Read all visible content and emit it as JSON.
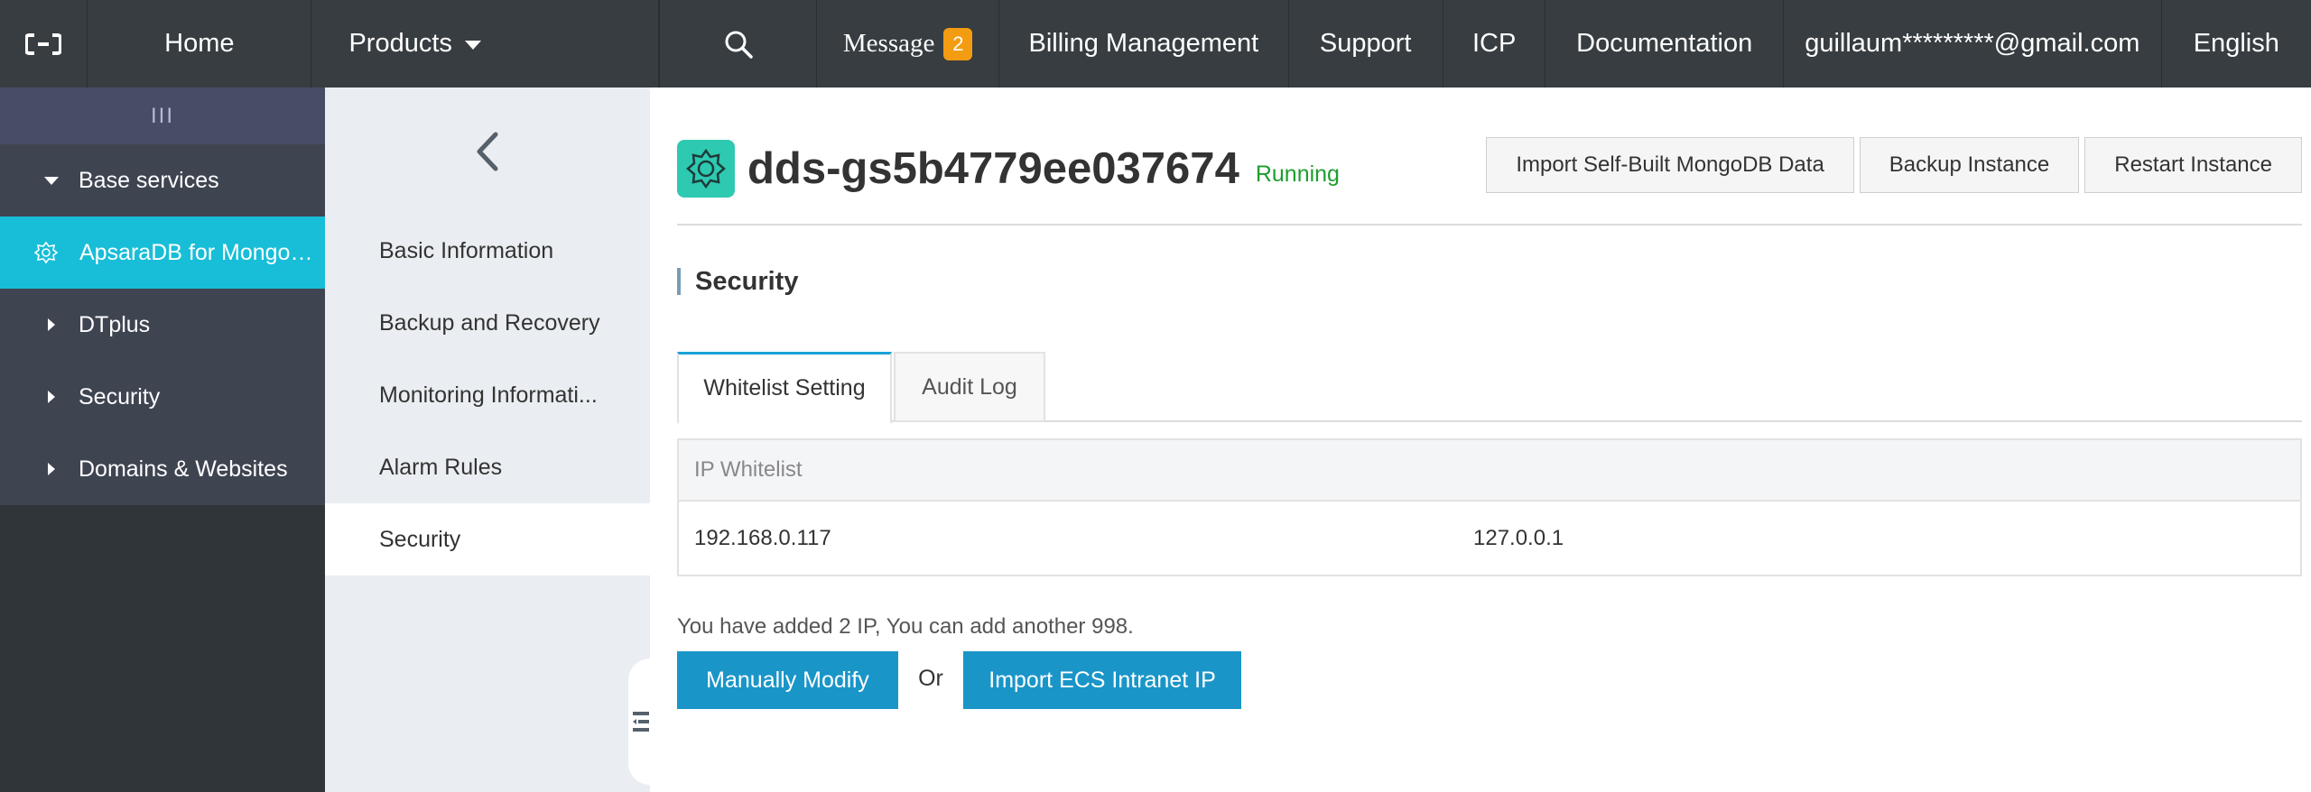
{
  "topbar": {
    "logo_icon": "aliyun-logo-icon",
    "home": "Home",
    "products": "Products",
    "message": "Message",
    "message_count": "2",
    "billing": "Billing Management",
    "support": "Support",
    "icp": "ICP",
    "documentation": "Documentation",
    "account": "guillaum*********@gmail.com",
    "language": "English"
  },
  "sidebar": {
    "collapse_glyph": "III",
    "items": [
      {
        "label": "Base services",
        "state": "expanded"
      },
      {
        "label": "ApsaraDB for MongoDB",
        "state": "active"
      },
      {
        "label": "DTplus",
        "state": "collapsed"
      },
      {
        "label": "Security",
        "state": "collapsed"
      },
      {
        "label": "Domains & Websites",
        "state": "collapsed"
      }
    ]
  },
  "subnav": {
    "items": [
      {
        "label": "Basic Information"
      },
      {
        "label": "Backup and Recovery"
      },
      {
        "label": "Monitoring Informati..."
      },
      {
        "label": "Alarm Rules"
      },
      {
        "label": "Security",
        "active": true
      }
    ]
  },
  "instance": {
    "name": "dds-gs5b4779ee037674",
    "status": "Running",
    "status_color": "#1e9e2f",
    "buttons": {
      "import": "Import Self-Built MongoDB Data",
      "backup": "Backup Instance",
      "restart": "Restart Instance"
    }
  },
  "security": {
    "section_title": "Security",
    "tabs": [
      {
        "label": "Whitelist Setting",
        "active": true
      },
      {
        "label": "Audit Log",
        "active": false
      }
    ],
    "table": {
      "header": "IP Whitelist",
      "ips": [
        "192.168.0.117",
        "127.0.0.1"
      ]
    },
    "note": "You have added 2 IP, You can add another 998.",
    "manual_modify": "Manually Modify",
    "or": "Or",
    "import_ecs": "Import ECS Intranet IP"
  },
  "colors": {
    "topbar_bg": "#373d41",
    "accent_cyan": "#18bed7",
    "primary_button": "#1a95c8",
    "badge": "#f39c12"
  }
}
